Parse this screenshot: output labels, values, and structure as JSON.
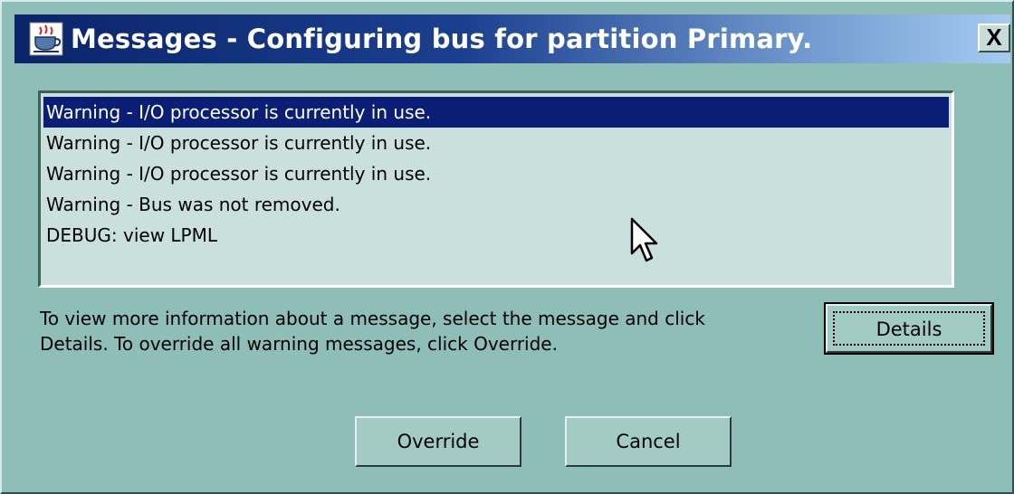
{
  "window": {
    "title": "Messages - Configuring bus for partition Primary.",
    "app_icon": "java-coffee-cup-icon",
    "close_label": "X"
  },
  "messages": [
    {
      "text": "Warning - I/O processor is currently in use.",
      "selected": true
    },
    {
      "text": "Warning - I/O processor is currently in use.",
      "selected": false
    },
    {
      "text": "Warning - I/O processor is currently in use.",
      "selected": false
    },
    {
      "text": "Warning - Bus was not removed.",
      "selected": false
    },
    {
      "text": "DEBUG: view LPML",
      "selected": false
    }
  ],
  "instructions": {
    "line1": "To view more information about a message, select the message and click",
    "line2": "Details.  To override all warning messages, click Override."
  },
  "buttons": {
    "details": "Details",
    "override": "Override",
    "cancel": "Cancel"
  },
  "colors": {
    "window_bg": "#8fbdb7",
    "list_bg": "#c9e0dc",
    "selection": "#0a1e76",
    "title_start": "#0a246a",
    "title_end": "#a6caf0"
  }
}
